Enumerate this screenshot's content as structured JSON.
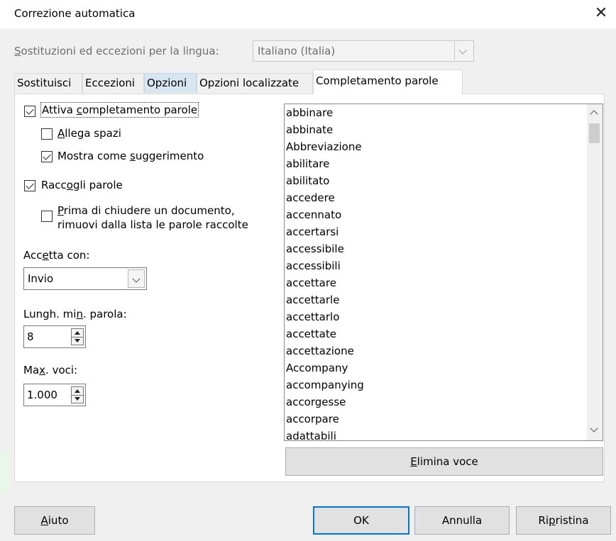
{
  "window": {
    "title": "Correzione automatica",
    "close_icon": "close-icon"
  },
  "language": {
    "label_underlined": "S",
    "label_rest": "ostituzioni ed eccezioni per la lingua:",
    "value": "Italiano (Italia)"
  },
  "tabs": [
    {
      "label": "Sostituisci"
    },
    {
      "label": "Eccezioni"
    },
    {
      "label": "Opzioni"
    },
    {
      "label": "Opzioni localizzate"
    },
    {
      "label": "Completamento parole"
    }
  ],
  "options": {
    "enable": {
      "pre": "Attiva ",
      "u": "c",
      "post": "ompletamento parole",
      "checked": true
    },
    "append": {
      "pre": "",
      "u": "A",
      "post": "llega spazi",
      "checked": false
    },
    "show_tip": {
      "pre": "Mostra come ",
      "u": "s",
      "post": "uggerimento",
      "checked": true
    },
    "collect": {
      "pre": "Racc",
      "u": "o",
      "post": "gli parole",
      "checked": true
    },
    "remove": {
      "pre": "",
      "u": "P",
      "post": "rima di chiudere un documento,",
      "line2": "rimuovi dalla lista le parole raccolte",
      "checked": false
    }
  },
  "accept": {
    "pre": "Acc",
    "u": "e",
    "post": "tta con:",
    "value": "Invio"
  },
  "min_len": {
    "pre": "Lungh. mi",
    "u": "n",
    "post": ". parola:",
    "value": "8"
  },
  "max_entries": {
    "pre": "Ma",
    "u": "x",
    "post": ". voci:",
    "value": "1.000"
  },
  "word_list": [
    "abbinare",
    "abbinate",
    "Abbreviazione",
    "abilitare",
    "abilitato",
    "accedere",
    "accennato",
    "accertarsi",
    "accessibile",
    "accessibili",
    "accettare",
    "accettarle",
    "accettarlo",
    "accettate",
    "accettazione",
    "Accompany",
    "accompanying",
    "accorgesse",
    "accorpare",
    "adattabili"
  ],
  "delete_button": {
    "u": "E",
    "post": "limina voce"
  },
  "footer": {
    "help": {
      "u": "A",
      "post": "iuto"
    },
    "ok": "OK",
    "cancel": "Annulla",
    "reset": {
      "pre": "Ri",
      "u": "p",
      "post": "ristina"
    }
  }
}
